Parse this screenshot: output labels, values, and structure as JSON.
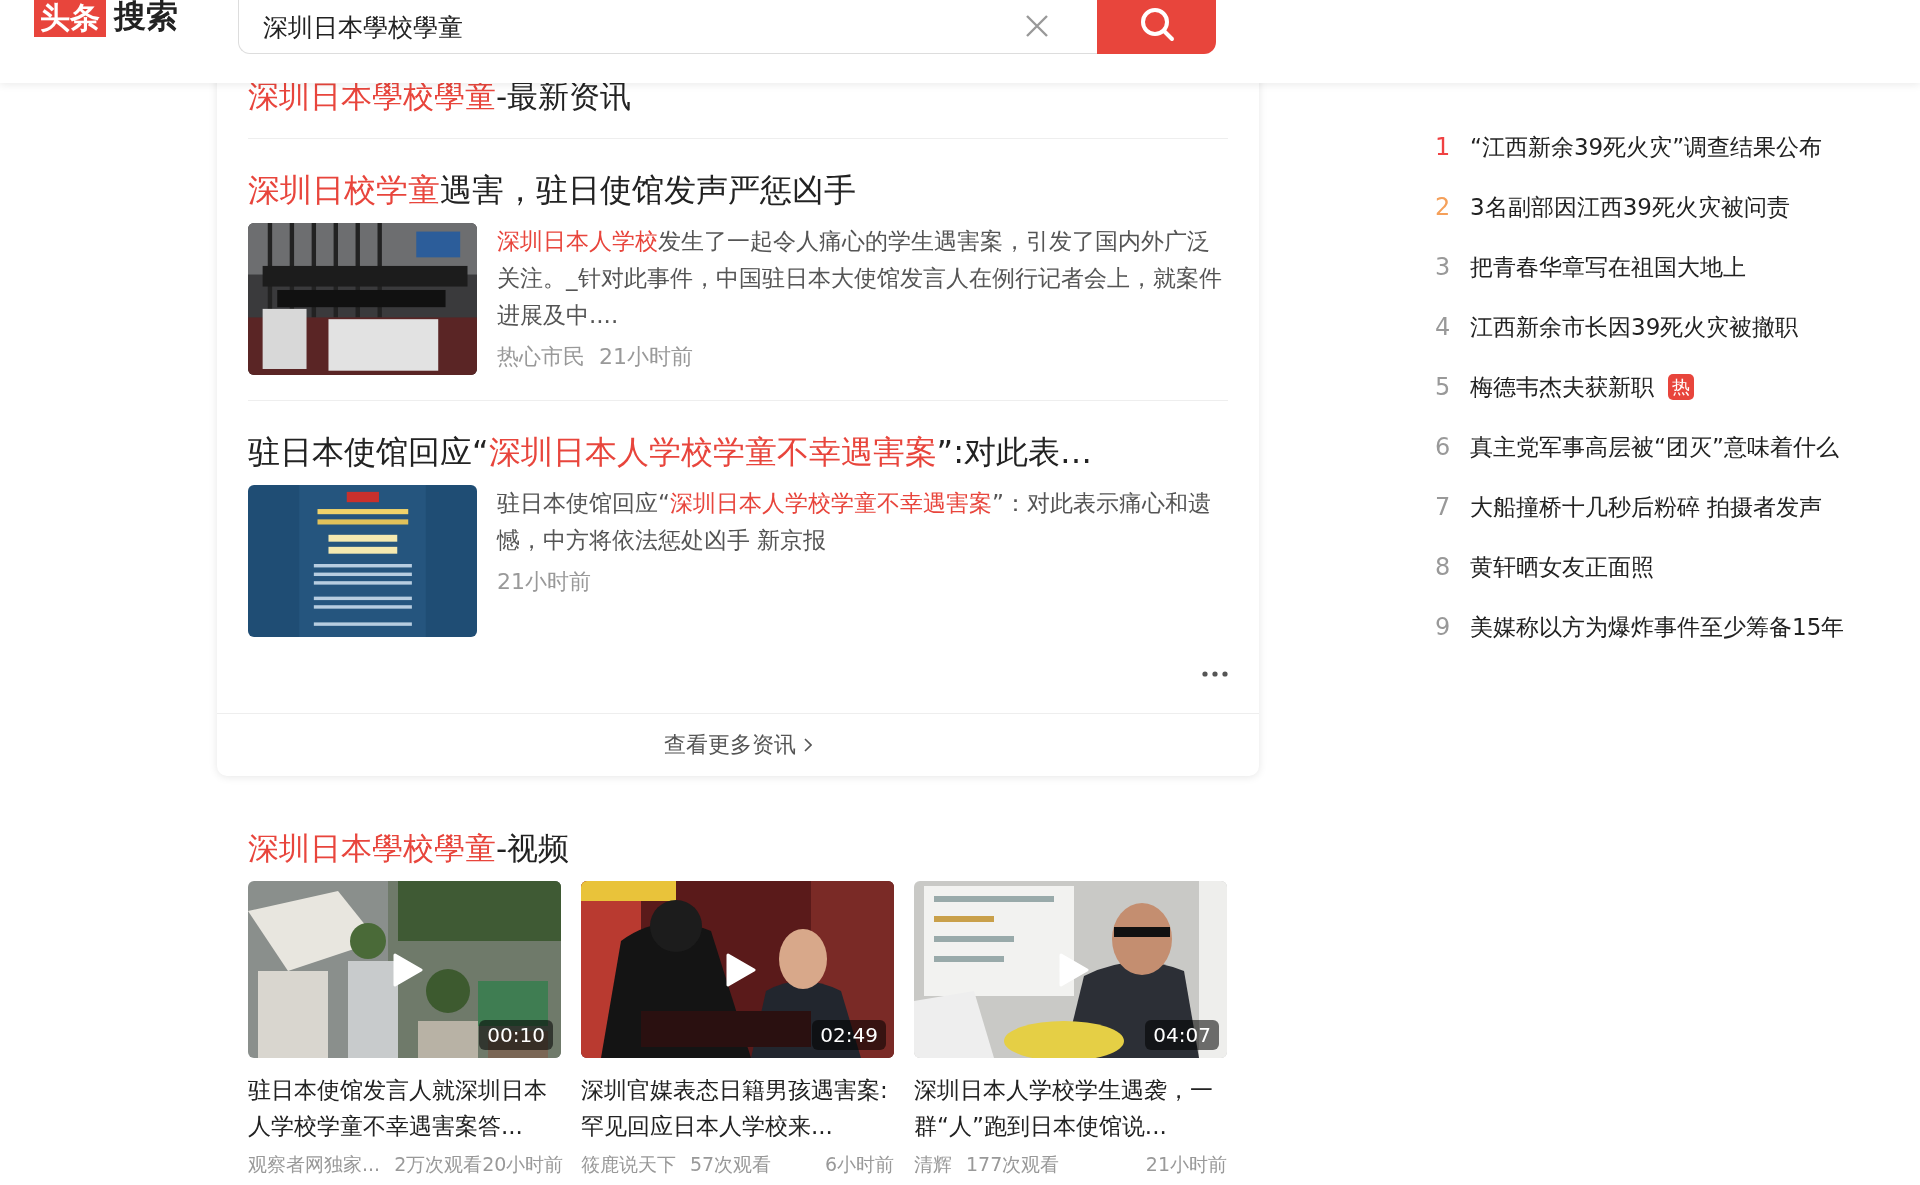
{
  "header": {
    "logo": {
      "badge": "头条",
      "text": "搜索"
    },
    "search": {
      "value": "深圳日本學校學童"
    }
  },
  "news": {
    "title": {
      "highlight": "深圳日本學校學童",
      "rest": "-最新资讯"
    },
    "articles": [
      {
        "title": [
          {
            "text": "深圳日校学童",
            "hl": true
          },
          {
            "text": "遇害，驻日使馆发声严惩凶手",
            "hl": false
          }
        ],
        "snippet": [
          {
            "text": "深圳日本人学校",
            "hl": true
          },
          {
            "text": "发生了一起令人痛心的学生遇害案，引发了国内外广泛关注。_针对此事件，中国驻日本大使馆发言人在例行记者会上，就案件进展及中....",
            "hl": false
          }
        ],
        "source": "热心市民",
        "time": "21小时前"
      },
      {
        "title": [
          {
            "text": "驻日本使馆回应“",
            "hl": false
          },
          {
            "text": "深圳日本人学校学童不幸遇害案",
            "hl": true
          },
          {
            "text": "”:对此表…",
            "hl": false
          }
        ],
        "snippet": [
          {
            "text": "驻日本使馆回应“",
            "hl": false
          },
          {
            "text": "深圳日本人学校学童不幸遇害案",
            "hl": true
          },
          {
            "text": "”：对此表示痛心和遗憾，中方将依法惩处凶手 新京报",
            "hl": false
          }
        ],
        "time": "21小时前"
      }
    ],
    "more": "查看更多资讯"
  },
  "videos": {
    "title": {
      "highlight": "深圳日本學校學童",
      "rest": "-视频"
    },
    "items": [
      {
        "duration": "00:10",
        "caption": "驻日本使馆发言人就深圳日本人学校学童不幸遇害案答...",
        "source": "观察者网独家...",
        "views": "2万次观看",
        "time": "20小时前"
      },
      {
        "duration": "02:49",
        "caption": "深圳官媒表态日籍男孩遇害案:罕见回应日本人学校来...",
        "source": "筱鹿说天下",
        "views": "57次观看",
        "time": "6小时前"
      },
      {
        "duration": "04:07",
        "caption": "深圳日本人学校学生遇袭，一群“人”跑到日本使馆说...",
        "source": "清辉",
        "views": "177次观看",
        "time": "21小时前"
      }
    ]
  },
  "hot_list": [
    {
      "kind": "ranked",
      "rank": "1",
      "text": "“江西新余39死火灾”调查结果公布",
      "color": "#f04142"
    },
    {
      "kind": "ranked",
      "rank": "2",
      "text": "3名副部因江西39死火灾被问责",
      "color": "#f5a05a"
    },
    {
      "kind": "ranked",
      "rank": "3",
      "text": "把青春华章写在祖国大地上",
      "color": "#999999"
    },
    {
      "kind": "ranked",
      "rank": "4",
      "text": "江西新余市长因39死火灾被撤职",
      "color": "#999999"
    },
    {
      "kind": "ranked",
      "rank": "5",
      "text": "梅德韦杰夫获新职",
      "color": "#999999",
      "badge": "热"
    },
    {
      "kind": "ranked",
      "rank": "6",
      "text": "真主党军事高层被“团灭”意味着什么",
      "color": "#999999"
    },
    {
      "kind": "ranked",
      "rank": "7",
      "text": "大船撞桥十几秒后粉碎 拍摄者发声",
      "color": "#999999"
    },
    {
      "kind": "ranked",
      "rank": "8",
      "text": "黄轩晒女友正面照",
      "color": "#999999"
    },
    {
      "kind": "ranked",
      "rank": "9",
      "text": "美媒称以方为爆炸事件至少筹备15年",
      "color": "#999999"
    }
  ]
}
